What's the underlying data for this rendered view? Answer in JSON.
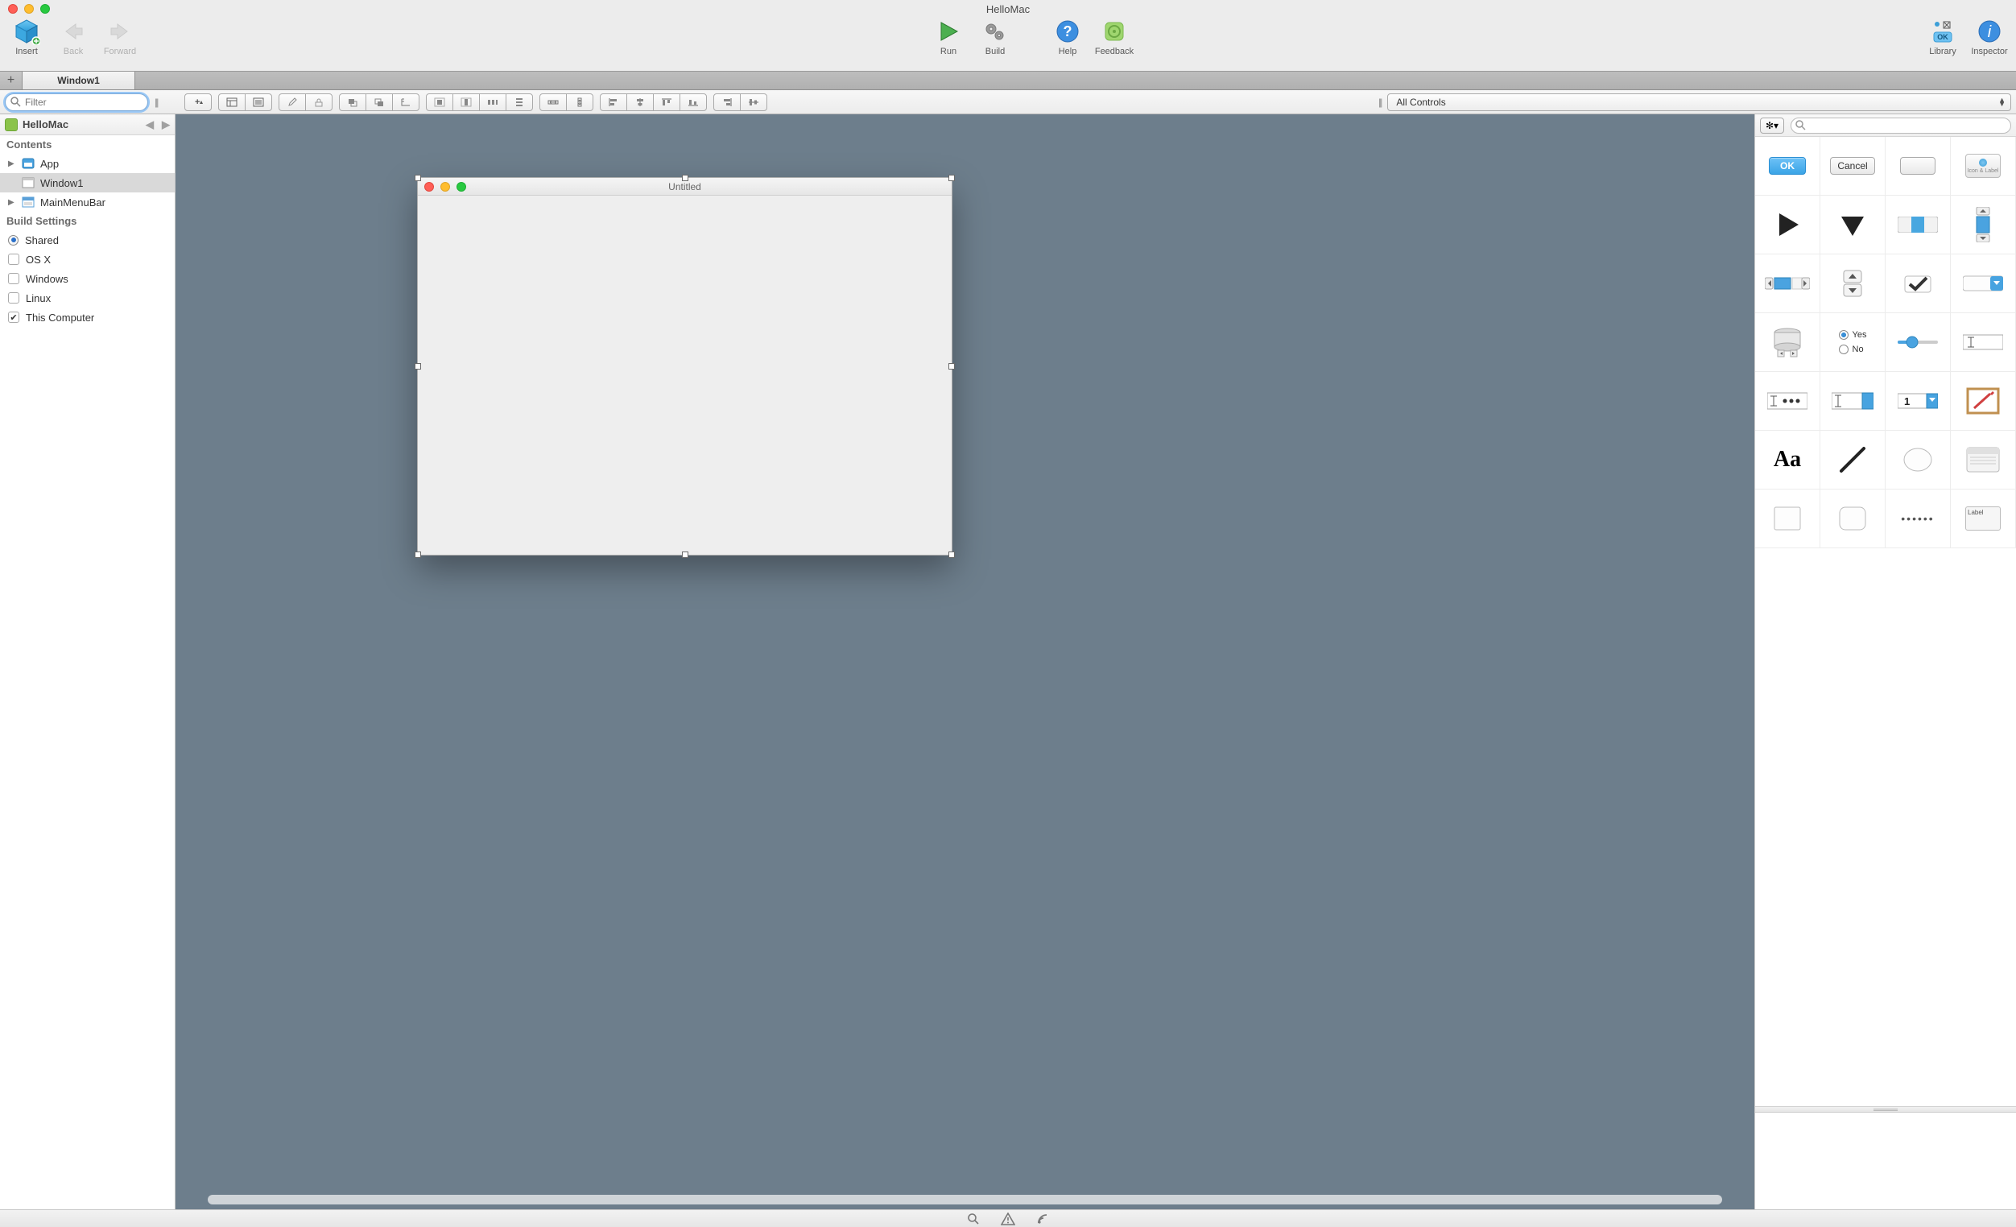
{
  "window_title": "HelloMac",
  "toolbar": {
    "insert": "Insert",
    "back": "Back",
    "forward": "Forward",
    "run": "Run",
    "build": "Build",
    "help": "Help",
    "feedback": "Feedback",
    "library": "Library",
    "inspector": "Inspector"
  },
  "tab": {
    "active": "Window1"
  },
  "filter": {
    "placeholder": "Filter"
  },
  "library_filter": {
    "label": "All Controls"
  },
  "navigator": {
    "project": "HelloMac",
    "sections": {
      "contents": "Contents",
      "build": "Build Settings"
    },
    "items": {
      "app": "App",
      "window1": "Window1",
      "mainmenu": "MainMenuBar"
    },
    "build_items": {
      "shared": "Shared",
      "osx": "OS X",
      "windows": "Windows",
      "linux": "Linux",
      "this_computer": "This Computer"
    }
  },
  "canvas": {
    "window_title": "Untitled"
  },
  "library": {
    "ok": "OK",
    "cancel": "Cancel",
    "icon_label": "Icon & Label",
    "yes": "Yes",
    "no": "No",
    "one": "1",
    "aa": "Aa",
    "label": "Label",
    "dots": "••••••"
  },
  "lib_search": {
    "placeholder": ""
  }
}
